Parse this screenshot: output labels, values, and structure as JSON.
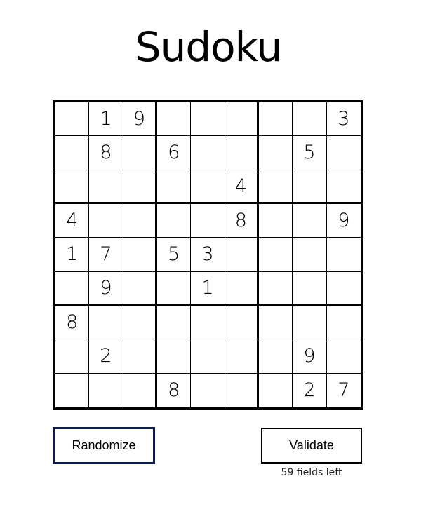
{
  "title": "Sudoku",
  "board": [
    [
      "",
      "1",
      "9",
      "",
      "",
      "",
      "",
      "",
      "3"
    ],
    [
      "",
      "8",
      "",
      "6",
      "",
      "",
      "",
      "5",
      ""
    ],
    [
      "",
      "",
      "",
      "",
      "",
      "4",
      "",
      "",
      ""
    ],
    [
      "4",
      "",
      "",
      "",
      "",
      "8",
      "",
      "",
      "9"
    ],
    [
      "1",
      "7",
      "",
      "5",
      "3",
      "",
      "",
      "",
      ""
    ],
    [
      "",
      "9",
      "",
      "",
      "1",
      "",
      "",
      "",
      ""
    ],
    [
      "8",
      "",
      "",
      "",
      "",
      "",
      "",
      "",
      ""
    ],
    [
      "",
      "2",
      "",
      "",
      "",
      "",
      "",
      "9",
      ""
    ],
    [
      "",
      "",
      "",
      "8",
      "",
      "",
      "",
      "2",
      "7"
    ]
  ],
  "buttons": {
    "randomize": "Randomize",
    "validate": "Validate"
  },
  "status": {
    "fields_left": "59 fields left"
  }
}
